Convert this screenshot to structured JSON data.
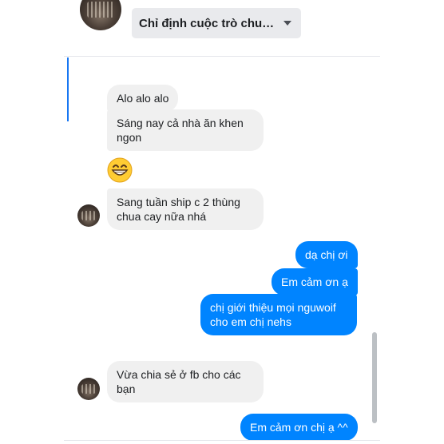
{
  "header": {
    "conversation_dropdown_label": "Chỉ định cuộc trò chu…"
  },
  "messages": [
    {
      "direction": "incoming",
      "text": "Alo alo alo"
    },
    {
      "direction": "incoming",
      "text": "Sáng nay cả nhà ăn khen ngon"
    },
    {
      "direction": "incoming",
      "emoji": "grinning-face"
    },
    {
      "direction": "incoming",
      "text": "Sang tuần ship c 2 thùng chua cay nữa nhá"
    },
    {
      "direction": "outgoing",
      "text": "dạ chị ơi"
    },
    {
      "direction": "outgoing",
      "text": "Em cảm ơn ạ"
    },
    {
      "direction": "outgoing",
      "text": "chị giới thiệu mọi nguwoif cho em chị nehs"
    },
    {
      "direction": "incoming",
      "text": "Vừa chia sẻ ở fb cho các bạn"
    },
    {
      "direction": "outgoing",
      "text": "Em cảm ơn chị ạ ^^"
    }
  ],
  "colors": {
    "outgoing_bubble": "#0084ff",
    "incoming_bubble": "#f0f0f0",
    "accent": "#1877f2"
  }
}
